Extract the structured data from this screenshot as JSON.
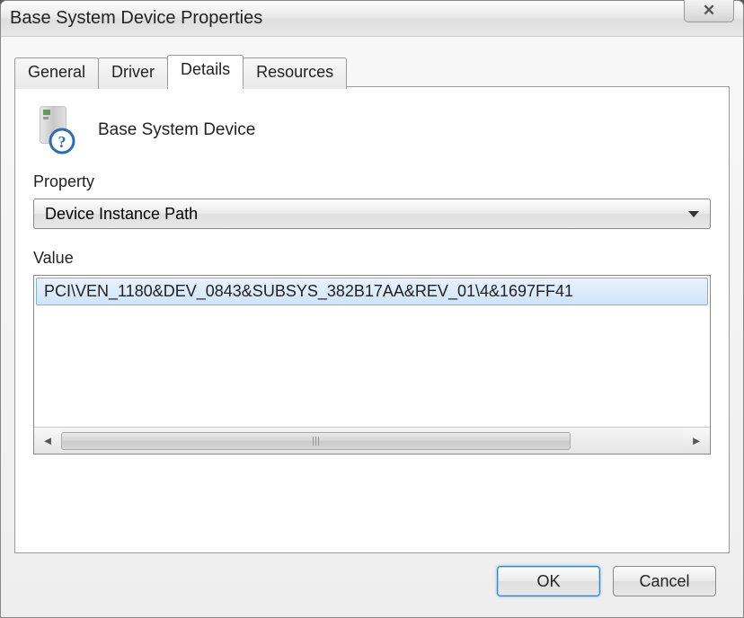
{
  "window": {
    "title": "Base System Device Properties",
    "close_glyph": "✕"
  },
  "tabs": {
    "general": "General",
    "driver": "Driver",
    "details": "Details",
    "resources": "Resources",
    "active": "details"
  },
  "device": {
    "name": "Base System Device"
  },
  "property": {
    "label": "Property",
    "selected": "Device Instance Path"
  },
  "value": {
    "label": "Value",
    "item": "PCI\\VEN_1180&DEV_0843&SUBSYS_382B17AA&REV_01\\4&1697FF41"
  },
  "buttons": {
    "ok": "OK",
    "cancel": "Cancel"
  },
  "scroll": {
    "left_glyph": "◄",
    "right_glyph": "►"
  }
}
